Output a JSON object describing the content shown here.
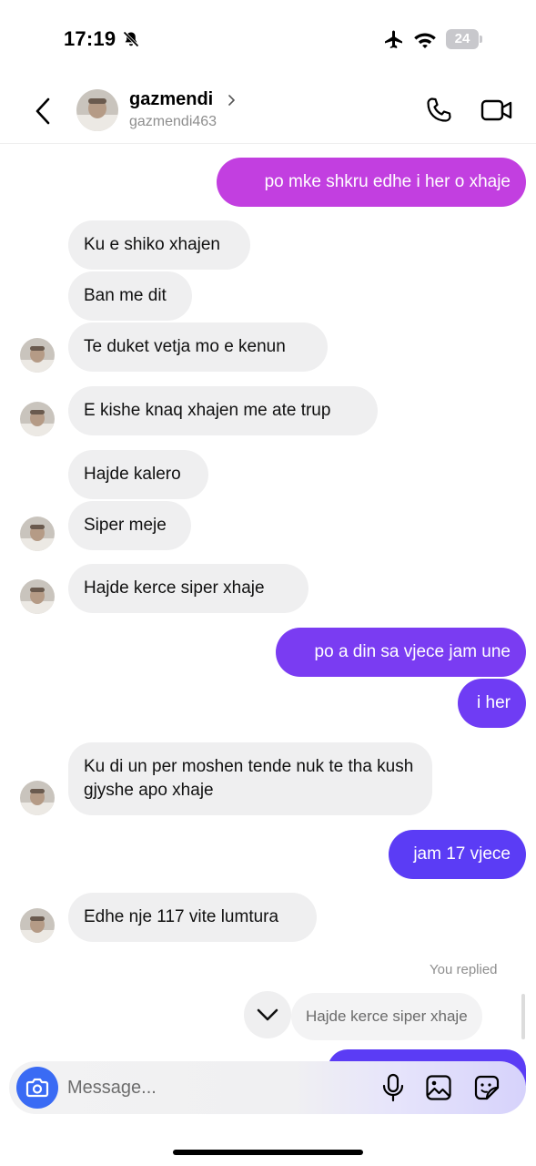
{
  "status_bar": {
    "time": "17:19",
    "battery": "24",
    "icons": [
      "bell-muted-icon",
      "airplane-icon",
      "wifi-icon",
      "battery-icon"
    ]
  },
  "header": {
    "name": "gazmendi",
    "username": "gazmendi463",
    "icons": [
      "back-icon",
      "chevron-right-icon",
      "phone-icon",
      "video-icon"
    ]
  },
  "messages": [
    {
      "from": "me",
      "text": "po mke shkru edhe i her o xhaje"
    },
    {
      "from": "them",
      "text": "Ku e shiko xhajen"
    },
    {
      "from": "them",
      "text": "Ban me dit"
    },
    {
      "from": "them",
      "text": "Te duket vetja mo e kenun"
    },
    {
      "from": "them",
      "text": "E kishe knaq xhajen me ate trup"
    },
    {
      "from": "them",
      "text": "Hajde kalero"
    },
    {
      "from": "them",
      "text": "Siper meje"
    },
    {
      "from": "them",
      "text": "Hajde kerce siper  xhaje"
    },
    {
      "from": "me",
      "text": "po a din sa vjece jam une"
    },
    {
      "from": "me",
      "text": "i her"
    },
    {
      "from": "them",
      "text": "Ku di un per moshen tende nuk te tha kush gjyshe apo xhaje"
    },
    {
      "from": "me",
      "text": "jam 17 vjece"
    },
    {
      "from": "them",
      "text": "Edhe nje 117 vite lumtura"
    }
  ],
  "reply": {
    "label": "You replied",
    "quoted_text": "Hajde kerce siper  xhaje"
  },
  "composer": {
    "placeholder": "Message...",
    "icons": [
      "camera-icon",
      "microphone-icon",
      "gallery-icon",
      "sticker-icon"
    ]
  },
  "colors": {
    "outgoing_top": "#c23fe0",
    "outgoing_mid": "#7a3cf2",
    "outgoing_bottom": "#5b3cf5",
    "incoming_bg": "#efeff0",
    "camera_button": "#3a6bf4"
  }
}
